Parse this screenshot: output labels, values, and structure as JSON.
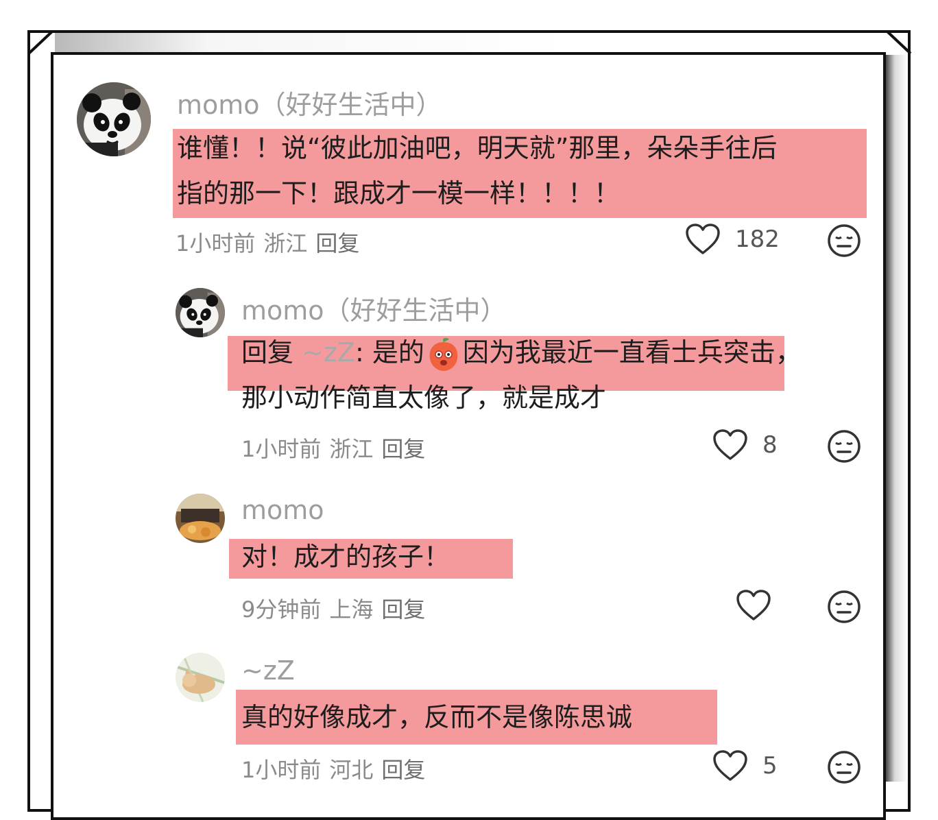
{
  "comments": [
    {
      "username": "momo（好好生活中）",
      "lines": [
        "谁懂！！说“彼此加油吧，明天就”那里，朵朵手往后",
        "指的那一下！跟成才一模一样！！！！"
      ],
      "time": "1小时前",
      "location": "浙江",
      "reply_label": "回复",
      "likes": "182",
      "avatar_icon": "panda-avatar"
    },
    {
      "username": "momo（好好生活中）",
      "reply_prefix": "回复",
      "mention": "~zZ",
      "line1_a": ": 是的",
      "emoji_icon": "shy-peach-emoji",
      "line1_b": "因为我最近一直看士兵突击，",
      "line2": "那小动作简直太像了，就是成才",
      "time": "1小时前",
      "location": "浙江",
      "reply_label": "回复",
      "likes": "8",
      "avatar_icon": "panda-avatar"
    },
    {
      "username": "momo",
      "line1": "对！成才的孩子！",
      "time": "9分钟前",
      "location": "上海",
      "reply_label": "回复",
      "likes": "",
      "avatar_icon": "food-photo-avatar"
    },
    {
      "username": "~zZ",
      "line1": "真的好像成才，反而不是像陈思诚",
      "time": "1小时前",
      "location": "河北",
      "reply_label": "回复",
      "likes": "5",
      "avatar_icon": "cat-photo-avatar"
    }
  ],
  "colors": {
    "highlight": "#f59a9c",
    "username": "#9d9d9d",
    "meta": "#8a8a8a",
    "text": "#1d1d1d"
  }
}
